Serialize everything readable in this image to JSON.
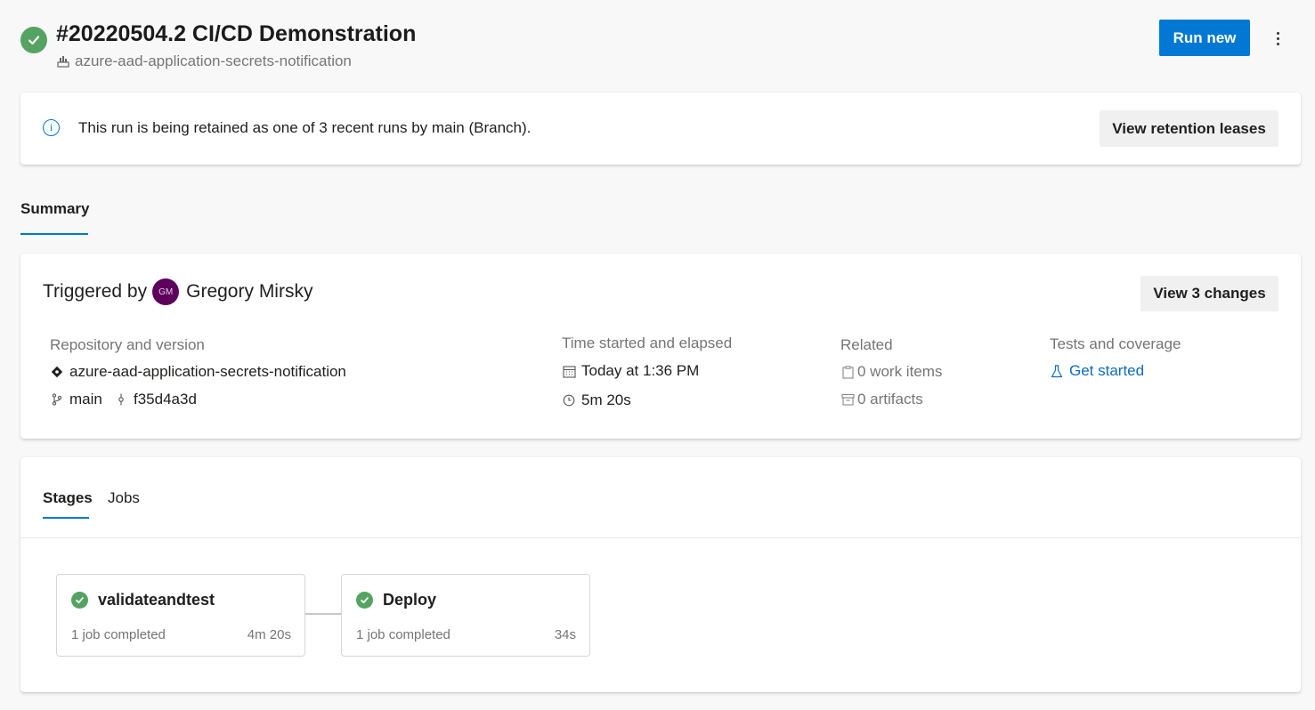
{
  "header": {
    "title": "#20220504.2 CI/CD Demonstration",
    "repo": "azure-aad-application-secrets-notification",
    "run_new_label": "Run new",
    "status_color": "#55a362"
  },
  "banner": {
    "message": "This run is being retained as one of 3 recent runs by main (Branch).",
    "button_label": "View retention leases"
  },
  "tabs": {
    "summary_label": "Summary"
  },
  "summary": {
    "triggered_prefix": "Triggered by",
    "avatar_initials": "GM",
    "user_name": "Gregory Mirsky",
    "view_changes_label": "View 3 changes",
    "repository": {
      "label": "Repository and version",
      "repo_name": "azure-aad-application-secrets-notification",
      "branch": "main",
      "commit": "f35d4a3d"
    },
    "time": {
      "label": "Time started and elapsed",
      "started": "Today at 1:36 PM",
      "elapsed": "5m 20s"
    },
    "related": {
      "label": "Related",
      "work_items": "0 work items",
      "artifacts": "0 artifacts"
    },
    "tests": {
      "label": "Tests and coverage",
      "link": "Get started"
    }
  },
  "stages_panel": {
    "tabs": [
      "Stages",
      "Jobs"
    ],
    "stages": [
      {
        "name": "validateandtest",
        "jobs": "1 job completed",
        "duration": "4m 20s"
      },
      {
        "name": "Deploy",
        "jobs": "1 job completed",
        "duration": "34s"
      }
    ]
  }
}
